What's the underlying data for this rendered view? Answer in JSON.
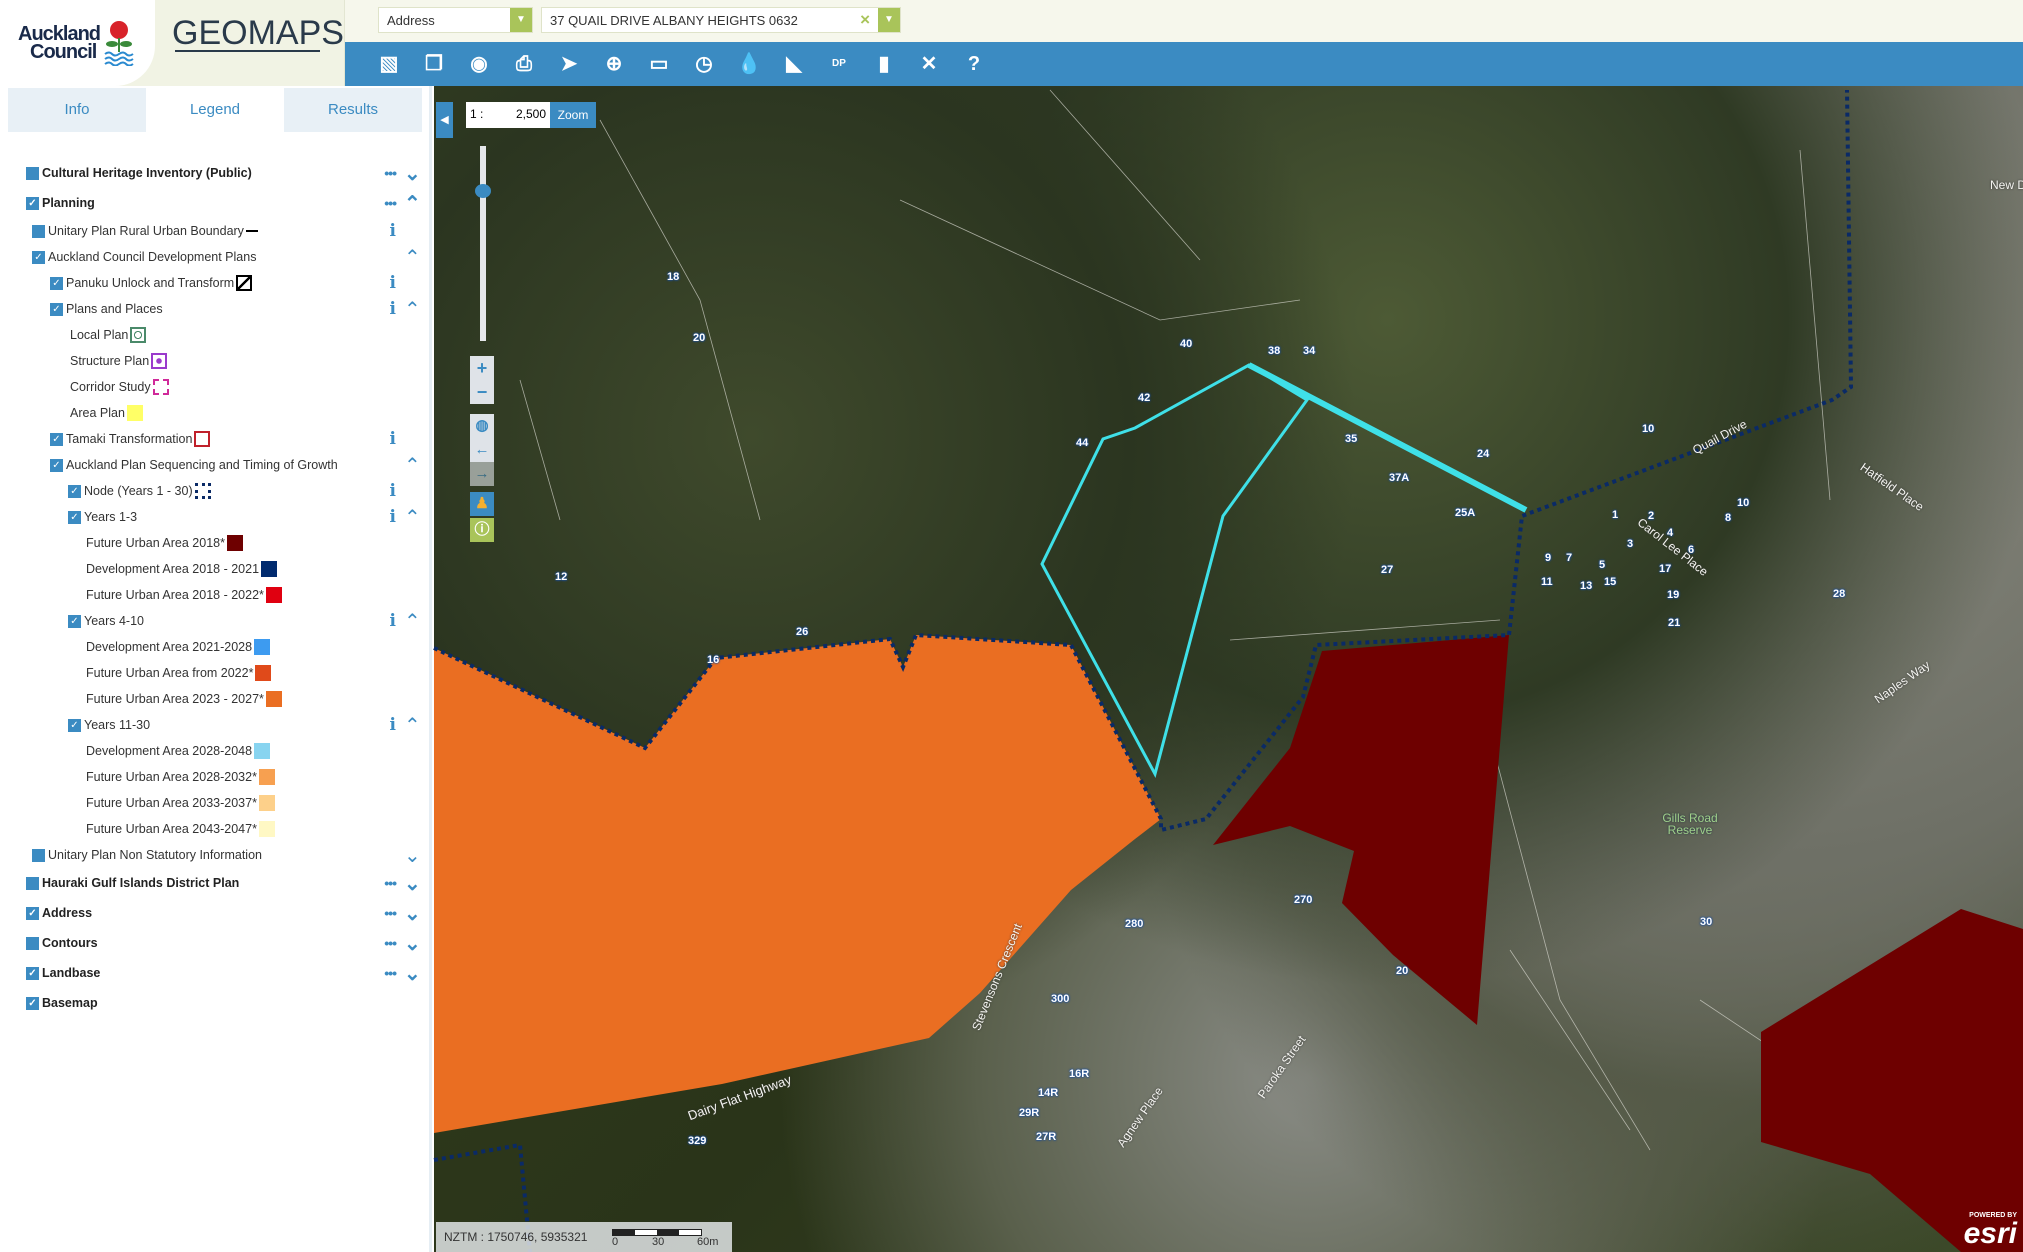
{
  "header": {
    "logo_line1": "Auckland",
    "logo_line2": "Council",
    "app_title": "GEOMAPS"
  },
  "search": {
    "type_value": "Address",
    "query_value": "37 QUAIL DRIVE ALBANY HEIGHTS 0632",
    "clear_icon": "×"
  },
  "toolbar": {
    "icons": [
      "map-gallery-icon",
      "layers-icon",
      "visibility-icon",
      "print-icon",
      "select-icon",
      "locate-icon",
      "measure-icon",
      "history-icon",
      "water-icon",
      "cctv-icon",
      "district-plan-icon",
      "bookmark-icon",
      "tools-icon",
      "help-icon"
    ],
    "help_label": "?",
    "dp_label": "DP"
  },
  "tabs": [
    {
      "label": "Info"
    },
    {
      "label": "Legend",
      "active": true
    },
    {
      "label": "Results"
    }
  ],
  "legend": [
    {
      "label": "Cultural Heritage Inventory (Public)",
      "level": 0,
      "top": true,
      "check": "off",
      "dots": true,
      "chev": "down"
    },
    {
      "label": "Planning",
      "level": 0,
      "top": true,
      "check": "on",
      "dots": true,
      "chev": "up"
    },
    {
      "label": "Unitary Plan Rural Urban Boundary",
      "level": 1,
      "check": "off",
      "swatch": "dash-black",
      "info": true
    },
    {
      "label": "Auckland Council Development Plans",
      "level": 1,
      "check": "on",
      "chev": "up"
    },
    {
      "label": "Panuku Unlock and Transform",
      "level": 2,
      "check": "on",
      "swatch": "hatch",
      "info": true
    },
    {
      "label": "Plans and Places",
      "level": 2,
      "check": "on",
      "info": true,
      "chev": "up"
    },
    {
      "label": "Local Plan",
      "level": 3,
      "swatch": "local"
    },
    {
      "label": "Structure Plan",
      "level": 3,
      "swatch": "structure"
    },
    {
      "label": "Corridor Study",
      "level": 3,
      "swatch": "corridor"
    },
    {
      "label": "Area Plan",
      "level": 3,
      "swatch": "#ffff66"
    },
    {
      "label": "Tamaki Transformation",
      "level": 2,
      "check": "on",
      "swatch": "tamaki",
      "info": true
    },
    {
      "label": "Auckland Plan Sequencing and Timing of Growth",
      "level": 2,
      "check": "on",
      "chev": "up"
    },
    {
      "label": "Node (Years 1 - 30)",
      "level": 3,
      "check": "on",
      "swatch": "node",
      "info": true
    },
    {
      "label": "Years 1-3",
      "level": 3,
      "check": "on",
      "info": true,
      "chev": "up"
    },
    {
      "label": "Future Urban Area 2018*",
      "level": 4,
      "swatch": "#6e0000"
    },
    {
      "label": "Development Area 2018 - 2021",
      "level": 4,
      "swatch": "#002a6e"
    },
    {
      "label": "Future Urban Area 2018 - 2022*",
      "level": 4,
      "swatch": "#e00010"
    },
    {
      "label": "Years 4-10",
      "level": 3,
      "check": "on",
      "info": true,
      "chev": "up"
    },
    {
      "label": "Development Area 2021-2028",
      "level": 4,
      "swatch": "#3d9bf0"
    },
    {
      "label": "Future Urban Area from 2022*",
      "level": 4,
      "swatch": "#e04a1a"
    },
    {
      "label": "Future Urban Area 2023 - 2027*",
      "level": 4,
      "swatch": "#ea6e22"
    },
    {
      "label": "Years 11-30",
      "level": 3,
      "check": "on",
      "info": true,
      "chev": "up"
    },
    {
      "label": "Development Area 2028-2048",
      "level": 4,
      "swatch": "#88d4f0"
    },
    {
      "label": "Future Urban Area 2028-2032*",
      "level": 4,
      "swatch": "#f7a050"
    },
    {
      "label": "Future Urban Area 2033-2037*",
      "level": 4,
      "swatch": "#fdd08a"
    },
    {
      "label": "Future Urban Area 2043-2047*",
      "level": 4,
      "swatch": "#fff8c4"
    },
    {
      "label": "Unitary Plan Non Statutory Information",
      "level": 1,
      "check": "off",
      "chev": "down"
    },
    {
      "label": "Hauraki Gulf Islands District Plan",
      "level": 0,
      "top": true,
      "check": "off",
      "dots": true,
      "chev": "down"
    },
    {
      "label": "Address",
      "level": 0,
      "top": true,
      "check": "on",
      "dots": true,
      "chev": "down"
    },
    {
      "label": "Contours",
      "level": 0,
      "top": true,
      "check": "off",
      "dots": true,
      "chev": "down"
    },
    {
      "label": "Landbase",
      "level": 0,
      "top": true,
      "check": "on",
      "dots": true,
      "chev": "down"
    },
    {
      "label": "Basemap",
      "level": 0,
      "top": true,
      "check": "on"
    }
  ],
  "map": {
    "scale_prefix": "1 :",
    "scale_value": "2,500",
    "zoom_label": "Zoom",
    "coords": "NZTM : 1750746, 5935321",
    "scalebar": [
      "0",
      "30",
      "60m"
    ],
    "attribution": "esri",
    "attribution_small": "POWERED BY",
    "colors": {
      "future_urban_2018": "#6e0000",
      "future_urban_2023_2027": "#ea6e22",
      "node": "#0a2a66",
      "selected": "#3fe0e8"
    },
    "street_labels": [
      {
        "text": "Quail Drive"
      },
      {
        "text": "Hatfield Place"
      },
      {
        "text": "Carol Lee Place"
      },
      {
        "text": "Dairy Flat Highway"
      },
      {
        "text": "Stevensons Crescent"
      },
      {
        "text": "Agnew Place"
      },
      {
        "text": "Paroka Street"
      },
      {
        "text": "Naples Way"
      },
      {
        "text": "New D"
      }
    ],
    "reserve_label": "Gills Road Reserve",
    "parcel_numbers": [
      "18",
      "20",
      "42",
      "40",
      "38",
      "34",
      "44",
      "35",
      "37A",
      "25A",
      "27",
      "24",
      "10",
      "12",
      "26",
      "16",
      "280",
      "270",
      "300",
      "329",
      "16R",
      "14R",
      "29R",
      "27R",
      "28",
      "30",
      "20",
      "1",
      "2",
      "3",
      "4",
      "5",
      "6",
      "7",
      "8",
      "9",
      "10",
      "11",
      "13",
      "15",
      "17",
      "19",
      "21"
    ]
  }
}
